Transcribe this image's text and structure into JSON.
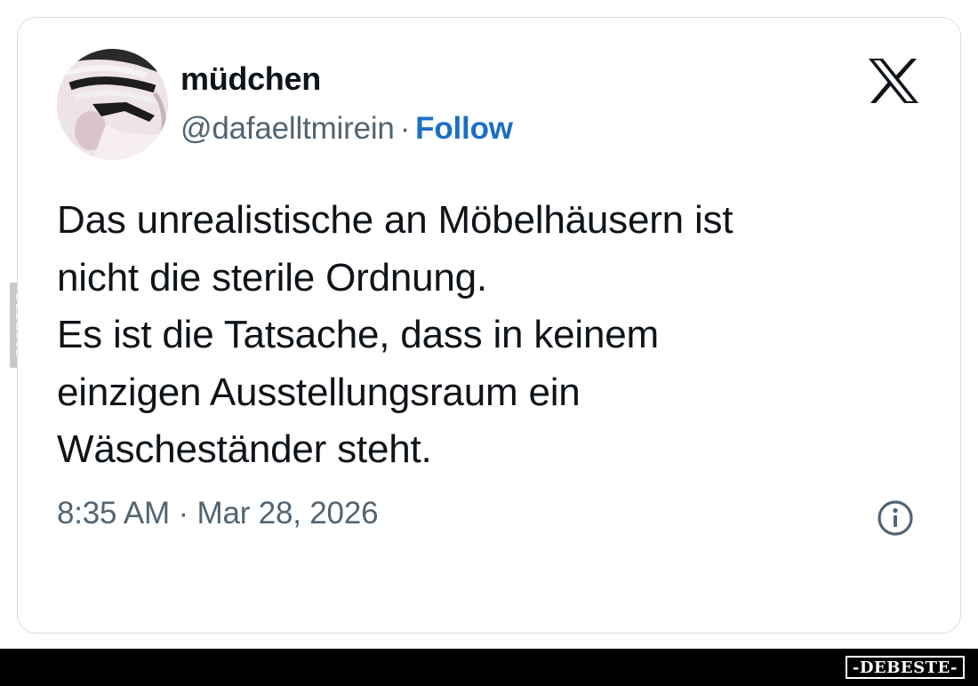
{
  "watermark": {
    "side_text": "DEBESTE",
    "footer_text": "-DEBESTE-"
  },
  "tweet": {
    "display_name": "müdchen",
    "handle": "@dafaelltmirein",
    "separator": "·",
    "follow_label": "Follow",
    "text_lines": [
      "Das unrealistische an Möbelhäusern ist",
      "nicht die sterile Ordnung.",
      "Es ist die Tatsache, dass in keinem",
      "einzigen Ausstellungsraum ein",
      "Wäscheständer steht."
    ],
    "timestamp": "8:35 AM · Mar 28, 2026"
  },
  "icons": {
    "brand": "x-logo-icon",
    "info": "info-icon",
    "avatar": "avatar-photo"
  },
  "colors": {
    "text": "#0f1419",
    "secondary": "#536471",
    "link": "#1d6fc4",
    "border": "#d8dde2",
    "footer": "#000000"
  }
}
